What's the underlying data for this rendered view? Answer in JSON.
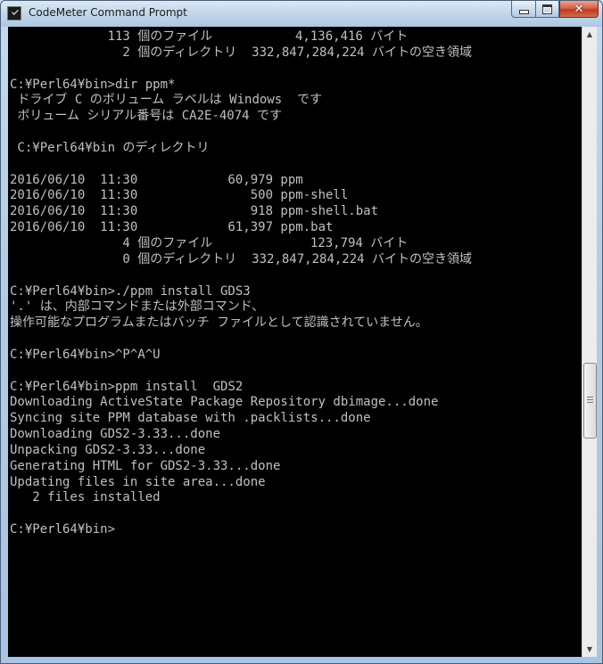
{
  "window": {
    "title": "CodeMeter Command Prompt",
    "icon": "console-icon",
    "controls": {
      "minimize_icon": "minimize-icon",
      "maximize_icon": "maximize-icon",
      "close_icon": "close-icon",
      "close_glyph": "✕"
    }
  },
  "colors": {
    "console_bg": "#000000",
    "console_text": "#c0c0c0",
    "close_button": "#c13a22"
  },
  "scrollbar": {
    "up_glyph": "▲",
    "down_glyph": "▼"
  },
  "console": {
    "lines": [
      "             113 個のファイル           4,136,416 バイト",
      "               2 個のディレクトリ  332,847,284,224 バイトの空き領域",
      "",
      "C:¥Perl64¥bin>dir ppm*",
      " ドライブ C のボリューム ラベルは Windows  です",
      " ボリューム シリアル番号は CA2E-4074 です",
      "",
      " C:¥Perl64¥bin のディレクトリ",
      "",
      "2016/06/10  11:30            60,979 ppm",
      "2016/06/10  11:30               500 ppm-shell",
      "2016/06/10  11:30               918 ppm-shell.bat",
      "2016/06/10  11:30            61,397 ppm.bat",
      "               4 個のファイル             123,794 バイト",
      "               0 個のディレクトリ  332,847,284,224 バイトの空き領域",
      "",
      "C:¥Perl64¥bin>./ppm install GDS3",
      "'.' は、内部コマンドまたは外部コマンド、",
      "操作可能なプログラムまたはバッチ ファイルとして認識されていません。",
      "",
      "C:¥Perl64¥bin>^P^A^U",
      "",
      "C:¥Perl64¥bin>ppm install  GDS2",
      "Downloading ActiveState Package Repository dbimage...done",
      "Syncing site PPM database with .packlists...done",
      "Downloading GDS2-3.33...done",
      "Unpacking GDS2-3.33...done",
      "Generating HTML for GDS2-3.33...done",
      "Updating files in site area...done",
      "   2 files installed",
      "",
      "C:¥Perl64¥bin>"
    ]
  }
}
